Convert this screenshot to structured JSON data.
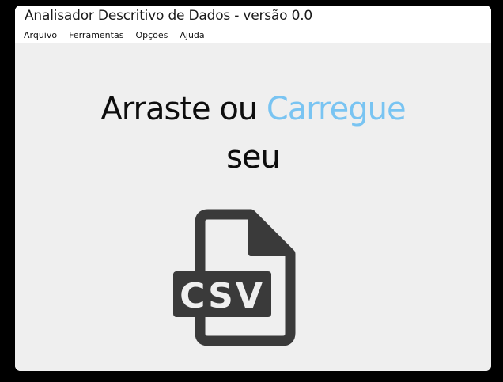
{
  "window": {
    "title": "Analisador Descritivo de Dados - versão 0.0"
  },
  "menubar": {
    "items": [
      {
        "label": "Arquivo"
      },
      {
        "label": "Ferramentas"
      },
      {
        "label": "Opções"
      },
      {
        "label": "Ajuda"
      }
    ]
  },
  "dropzone": {
    "prompt_prefix": "Arraste ou ",
    "prompt_link": "Carregue",
    "prompt_suffix": "seu",
    "file_icon": {
      "name": "csv-file-icon",
      "label": "CSV"
    }
  },
  "colors": {
    "background": "#000000",
    "window": "#efefef",
    "accent_link": "#79c4f2",
    "icon": "#3a3a3a"
  }
}
